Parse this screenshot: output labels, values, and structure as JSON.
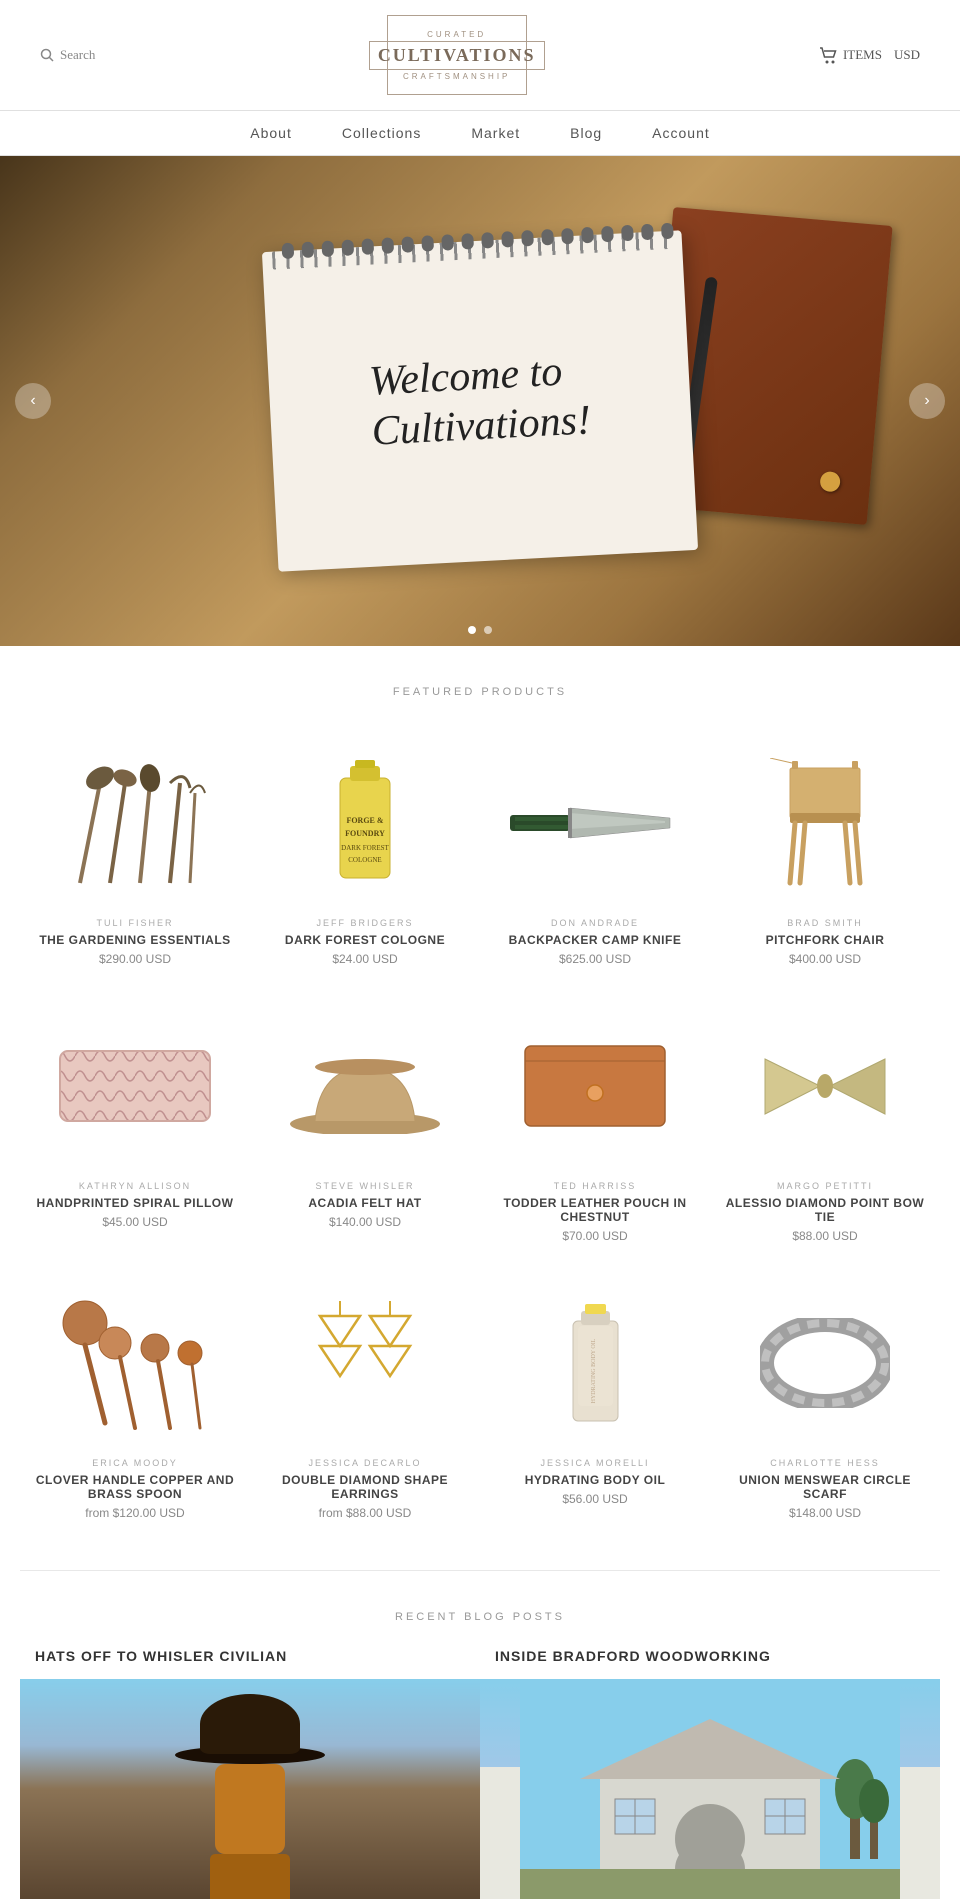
{
  "header": {
    "search_label": "Search",
    "logo_top": "CURATED",
    "logo_main": "CULTIVATIONS",
    "logo_bottom": "CRAFTSMANSHIP",
    "cart_label": "ITEMS",
    "currency": "USD"
  },
  "nav": {
    "items": [
      {
        "label": "About",
        "href": "#"
      },
      {
        "label": "Collections",
        "href": "#"
      },
      {
        "label": "Market",
        "href": "#"
      },
      {
        "label": "Blog",
        "href": "#"
      },
      {
        "label": "Account",
        "href": "#"
      }
    ]
  },
  "hero": {
    "text_line1": "Welcome to",
    "text_line2": "Cultivations!"
  },
  "featured_section": {
    "title": "FEATURED PRODUCTS",
    "products": [
      {
        "artist": "TULI FISHER",
        "name": "THE GARDENING ESSENTIALS",
        "price": "$290.00 USD",
        "shape": "garden"
      },
      {
        "artist": "JEFF BRIDGERS",
        "name": "DARK FOREST COLOGNE",
        "price": "$24.00 USD",
        "shape": "cologne"
      },
      {
        "artist": "DON ANDRADE",
        "name": "BACKPACKER CAMP KNIFE",
        "price": "$625.00 USD",
        "shape": "knife"
      },
      {
        "artist": "BRAD SMITH",
        "name": "PITCHFORK CHAIR",
        "price": "$400.00 USD",
        "shape": "chair"
      },
      {
        "artist": "KATHRYN ALLISON",
        "name": "HANDPRINTED SPIRAL PILLOW",
        "price": "$45.00 USD",
        "shape": "pillow"
      },
      {
        "artist": "STEVE WHISLER",
        "name": "ACADIA FELT HAT",
        "price": "$140.00 USD",
        "shape": "hat"
      },
      {
        "artist": "TED HARRISS",
        "name": "TODDER LEATHER POUCH IN CHESTNUT",
        "price": "$70.00 USD",
        "shape": "pouch"
      },
      {
        "artist": "MARGO PETITTI",
        "name": "ALESSIO DIAMOND POINT BOW TIE",
        "price": "$88.00 USD",
        "shape": "bowtie"
      },
      {
        "artist": "ERICA MOODY",
        "name": "CLOVER HANDLE COPPER AND BRASS SPOON",
        "price": "from $120.00 USD",
        "shape": "spoon"
      },
      {
        "artist": "JESSICA DECARLO",
        "name": "DOUBLE DIAMOND SHAPE EARRINGS",
        "price": "from $88.00 USD",
        "shape": "earring"
      },
      {
        "artist": "JESSICA MORELLI",
        "name": "HYDRATING BODY OIL",
        "price": "$56.00 USD",
        "shape": "oil"
      },
      {
        "artist": "CHARLOTTE HESS",
        "name": "UNION MENSWEAR CIRCLE SCARF",
        "price": "$148.00 USD",
        "shape": "scarf"
      }
    ]
  },
  "blog_section": {
    "title": "RECENT BLOG POSTS",
    "posts": [
      {
        "title": "HATS OFF TO WHISLER CIVILIAN"
      },
      {
        "title": "INSIDE BRADFORD WOODWORKING"
      }
    ]
  }
}
